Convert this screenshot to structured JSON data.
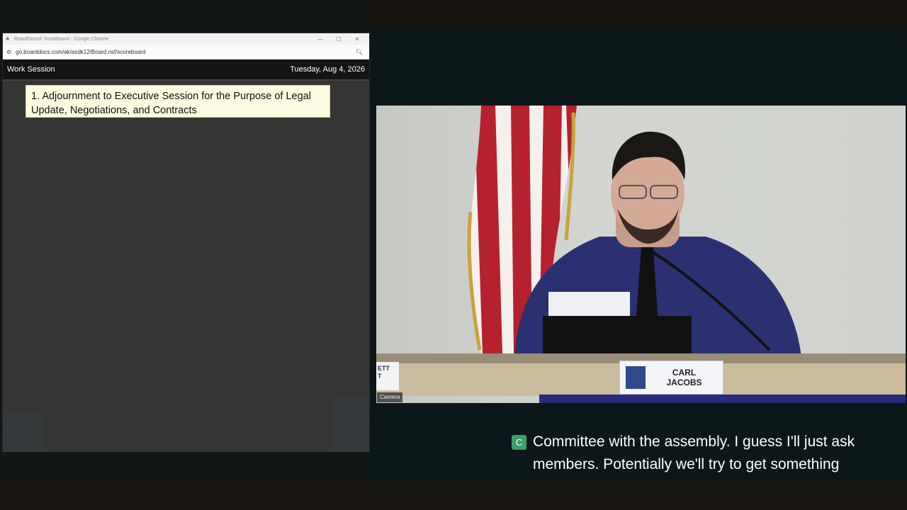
{
  "browser": {
    "window_title": "BoardDocs® Scoreboard - Google Chrome",
    "url": "go.boarddocs.com/ak/asdk12/Board.nsf/scoreboard",
    "controls": {
      "minimize": "—",
      "maximize": "☐",
      "close": "✕"
    },
    "icons": {
      "app": "tree-icon",
      "site_settings": "tune-icon",
      "search": "search-icon"
    }
  },
  "board": {
    "meeting_type": "Work Session",
    "date": "Tuesday, Aug 4, 2026",
    "agenda_item": "1. Adjournment to Executive Session for the Purpose of Legal Update, Negotiations, and Contracts"
  },
  "camera": {
    "label": "Camera",
    "nameplate": {
      "first": "CARL",
      "last": "JACOBS"
    },
    "partial_nameplate": [
      "ETT",
      "T"
    ]
  },
  "caption": {
    "badge": "C",
    "lines": [
      "Committee with the assembly. I guess I'll just ask",
      "members. Potentially we'll try to get something"
    ]
  },
  "colors": {
    "caption_badge": "#3aa06b",
    "agenda_bg": "#fdfbe0",
    "nameplate_logo": "#2d4a8a"
  }
}
